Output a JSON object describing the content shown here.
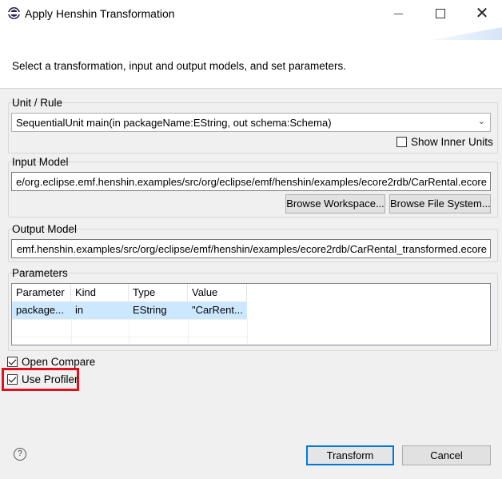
{
  "window": {
    "title": "Apply Henshin Transformation",
    "icon": "eclipse-icon",
    "controls": {
      "minimize": "—",
      "maximize": "☐",
      "close": "✕"
    }
  },
  "banner": {
    "message": "Select a transformation, input and output models, and set parameters."
  },
  "unit_rule": {
    "label": "Unit / Rule",
    "selected": "SequentialUnit main(in packageName:EString, out schema:Schema)",
    "show_inner_units": {
      "label": "Show Inner Units",
      "checked": false
    }
  },
  "input_model": {
    "label": "Input Model",
    "value": "platform:/resource/org.eclipse.emf.henshin.examples/src/org/eclipse/emf/henshin/examples/ecore2rdb/CarRental.ecore",
    "visible_value": "e/org.eclipse.emf.henshin.examples/src/org/eclipse/emf/henshin/examples/ecore2rdb/CarRental.ecore",
    "browse_workspace": "Browse Workspace...",
    "browse_file_system": "Browse File System..."
  },
  "output_model": {
    "label": "Output Model",
    "visible_value": "emf.henshin.examples/src/org/eclipse/emf/henshin/examples/ecore2rdb/CarRental_transformed.ecore"
  },
  "parameters": {
    "label": "Parameters",
    "columns": [
      "Parameter",
      "Kind",
      "Type",
      "Value"
    ],
    "rows": [
      [
        "package...",
        "in",
        "EString",
        "\"CarRent..."
      ]
    ]
  },
  "options": {
    "open_compare": {
      "label": "Open Compare",
      "checked": true
    },
    "use_profiler": {
      "label": "Use Profiler",
      "checked": true
    }
  },
  "footer": {
    "help": "?",
    "transform": "Transform",
    "cancel": "Cancel"
  },
  "colors": {
    "highlight": "#e0101c",
    "selection": "#cce8ff",
    "primary_border": "#0078d7"
  }
}
